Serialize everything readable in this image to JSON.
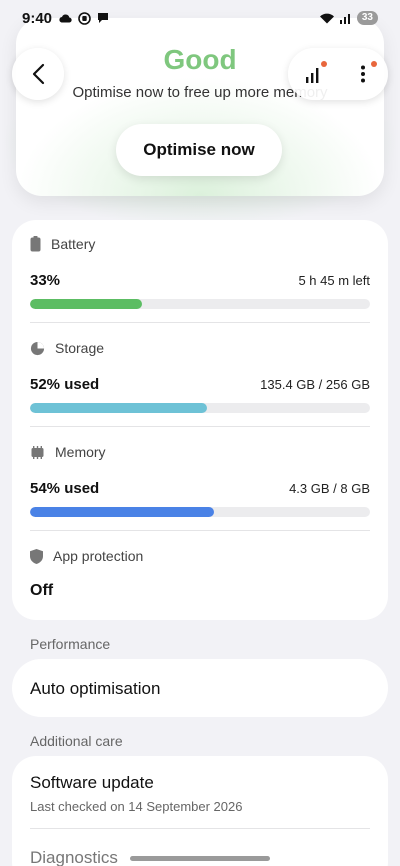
{
  "status_bar": {
    "time": "9:40",
    "battery_level": "33"
  },
  "hero": {
    "status": "Good",
    "subtitle": "Optimise now to free up more memory",
    "optimise_label": "Optimise now"
  },
  "battery": {
    "label": "Battery",
    "value": "33%",
    "detail": "5 h 45 m left",
    "fill": 0.33,
    "color": "#5cbd63"
  },
  "storage": {
    "label": "Storage",
    "value": "52% used",
    "detail": "135.4 GB / 256 GB",
    "fill": 0.52,
    "color": "#6ec2d6"
  },
  "memory": {
    "label": "Memory",
    "value": "54% used",
    "detail": "4.3 GB / 8 GB",
    "fill": 0.54,
    "color": "#4a82e6"
  },
  "app_protection": {
    "label": "App protection",
    "value": "Off"
  },
  "performance": {
    "group_label": "Performance",
    "auto_optimisation": "Auto optimisation"
  },
  "additional_care": {
    "group_label": "Additional care",
    "software_update": "Software update",
    "software_update_sub": "Last checked on 14 September 2026",
    "diagnostics": "Diagnostics"
  },
  "colors": {
    "good": "#7fc77e",
    "notification_dot": "#e8663c"
  }
}
